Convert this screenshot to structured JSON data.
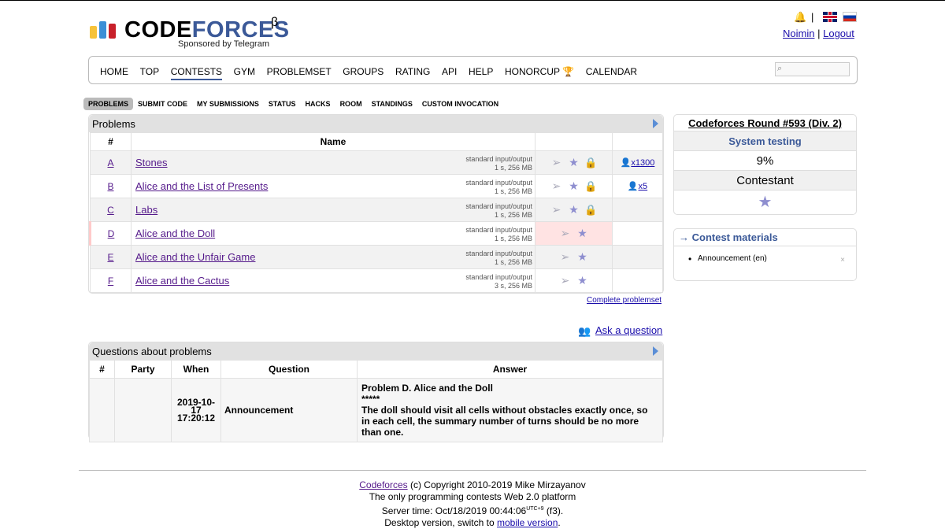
{
  "header": {
    "logo_part1": "CODE",
    "logo_part2": "FORCES",
    "logo_beta": "β",
    "logo_sub": "Sponsored by Telegram",
    "lang_separator": "|",
    "username": "Noimin",
    "user_separator": "|",
    "logout": "Logout"
  },
  "menu": {
    "items": [
      "HOME",
      "TOP",
      "CONTESTS",
      "GYM",
      "PROBLEMSET",
      "GROUPS",
      "RATING",
      "API",
      "HELP",
      "HONORCUP",
      "CALENDAR"
    ],
    "active": "CONTESTS"
  },
  "second_menu": [
    "PROBLEMS",
    "SUBMIT CODE",
    "MY SUBMISSIONS",
    "STATUS",
    "HACKS",
    "ROOM",
    "STANDINGS",
    "CUSTOM INVOCATION"
  ],
  "problems": {
    "title": "Problems",
    "headers": {
      "idx": "#",
      "name": "Name"
    },
    "rows": [
      {
        "idx": "A",
        "name": "Stones",
        "io": "standard input/output",
        "limits": "1 s, 256 MB",
        "solved": "x1300"
      },
      {
        "idx": "B",
        "name": "Alice and the List of Presents",
        "io": "standard input/output",
        "limits": "1 s, 256 MB",
        "solved": "x5"
      },
      {
        "idx": "C",
        "name": "Labs",
        "io": "standard input/output",
        "limits": "1 s, 256 MB",
        "solved": ""
      },
      {
        "idx": "D",
        "name": "Alice and the Doll",
        "io": "standard input/output",
        "limits": "1 s, 256 MB",
        "solved": ""
      },
      {
        "idx": "E",
        "name": "Alice and the Unfair Game",
        "io": "standard input/output",
        "limits": "1 s, 256 MB",
        "solved": ""
      },
      {
        "idx": "F",
        "name": "Alice and the Cactus",
        "io": "standard input/output",
        "limits": "3 s, 256 MB",
        "solved": ""
      }
    ],
    "complete_link": "Complete problemset",
    "ask_link": "Ask a question"
  },
  "questions": {
    "title": "Questions about problems",
    "headers": [
      "#",
      "Party",
      "When",
      "Question",
      "Answer"
    ],
    "row": {
      "when_date": "2019-10-17",
      "when_time": "17:20:12",
      "question": "Announcement",
      "answer_title": "Problem D. Alice and the Doll",
      "answer_stars": "*****",
      "answer_text": "The doll should visit all cells without obstacles exactly once, so in each cell, the summary number of turns should be no more than one."
    }
  },
  "sidebar": {
    "contest_title": "Codeforces Round #593 (Div. 2)",
    "phase": "System testing",
    "progress": "9%",
    "role": "Contestant",
    "materials_title": "→ Contest materials",
    "material_item": "Announcement (en)",
    "material_remove": "×"
  },
  "footer": {
    "site": "Codeforces",
    "copyright": "(c) Copyright 2010-2019 Mike Mirzayanov",
    "tagline": "The only programming contests Web 2.0 platform",
    "server_time_prefix": "Server time: Oct/18/2019 00:44:06",
    "tz": "UTC+9",
    "server_suffix": "(f3).",
    "desktop_prefix": "Desktop version, switch to",
    "mobile_link": "mobile version",
    "desktop_suffix": "."
  },
  "icons": {
    "send": "send-icon",
    "star": "star-icon",
    "lock": "lock-icon",
    "user": "user-icon",
    "search": "search-icon",
    "bell": "bell-icon"
  },
  "colors": {
    "accent": "#3b5998",
    "link": "#1a0dab",
    "visited": "#551a8b",
    "highlight": "#ffe3e3"
  }
}
